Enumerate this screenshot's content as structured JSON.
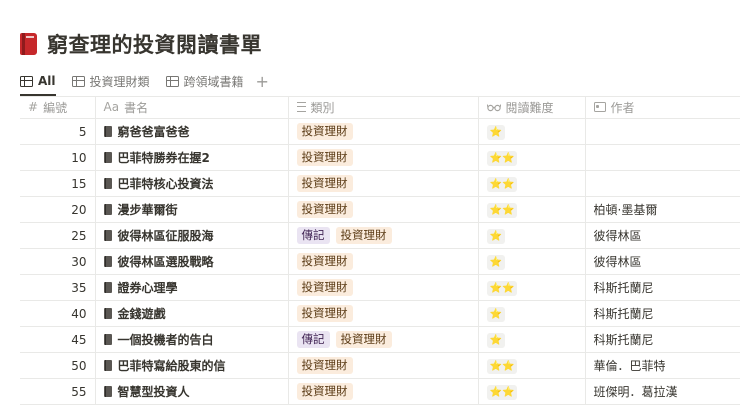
{
  "title": "窮查理的投資閱讀書單",
  "tabs": [
    {
      "label": "All",
      "active": true
    },
    {
      "label": "投資理財類",
      "active": false
    },
    {
      "label": "跨領域書籍",
      "active": false
    }
  ],
  "add_view_glyph": "+",
  "columns": {
    "number": {
      "icon": "#",
      "label": "編號"
    },
    "name": {
      "icon": "Aa",
      "label": "書名"
    },
    "category": {
      "label": "類別"
    },
    "difficulty": {
      "label": "閱讀難度"
    },
    "author": {
      "label": "作者"
    }
  },
  "rows": [
    {
      "number": "5",
      "name": "窮爸爸富爸爸",
      "tags": [
        "投資理財"
      ],
      "stars": "⭐",
      "author": ""
    },
    {
      "number": "10",
      "name": "巴菲特勝券在握2",
      "tags": [
        "投資理財"
      ],
      "stars": "⭐⭐",
      "author": ""
    },
    {
      "number": "15",
      "name": "巴菲特核心投資法",
      "tags": [
        "投資理財"
      ],
      "stars": "⭐⭐",
      "author": ""
    },
    {
      "number": "20",
      "name": "漫步華爾街",
      "tags": [
        "投資理財"
      ],
      "stars": "⭐⭐",
      "author": "柏頓·墨基爾"
    },
    {
      "number": "25",
      "name": "彼得林區征服股海",
      "tags": [
        "傳記",
        "投資理財"
      ],
      "stars": "⭐",
      "author": "彼得林區"
    },
    {
      "number": "30",
      "name": "彼得林區選股戰略",
      "tags": [
        "投資理財"
      ],
      "stars": "⭐",
      "author": "彼得林區"
    },
    {
      "number": "35",
      "name": "證券心理學",
      "tags": [
        "投資理財"
      ],
      "stars": "⭐⭐",
      "author": "科斯托蘭尼"
    },
    {
      "number": "40",
      "name": "金錢遊戲",
      "tags": [
        "投資理財"
      ],
      "stars": "⭐",
      "author": "科斯托蘭尼"
    },
    {
      "number": "45",
      "name": "一個投機者的告白",
      "tags": [
        "傳記",
        "投資理財"
      ],
      "stars": "⭐",
      "author": "科斯托蘭尼"
    },
    {
      "number": "50",
      "name": "巴菲特寫給股東的信",
      "tags": [
        "投資理財"
      ],
      "stars": "⭐⭐",
      "author": "華倫．巴菲特"
    },
    {
      "number": "55",
      "name": "智慧型投資人",
      "tags": [
        "投資理財"
      ],
      "stars": "⭐⭐",
      "author": "班傑明．葛拉漢"
    }
  ],
  "colors": {
    "tag_invest_bg": "#fbecdd",
    "tag_bio_bg": "#eae4f2",
    "title_book_red": "#c6282b"
  },
  "icons": {
    "title": "red-book-icon",
    "tab_view": "table-icon",
    "row": "book-icon"
  }
}
